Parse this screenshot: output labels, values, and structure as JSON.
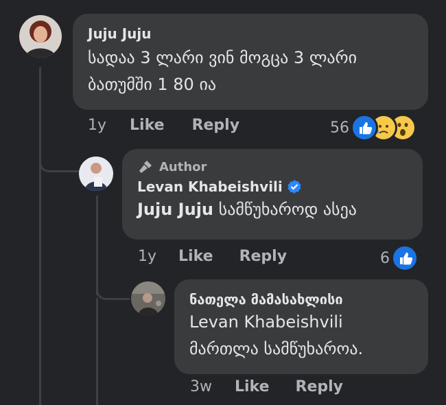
{
  "comments": [
    {
      "author": "Juju Juju",
      "text": "სადაა 3 ლარი ვინ მოგცა 3 ლარი ბათუმში 1 80 ია",
      "time": "1y",
      "like_label": "Like",
      "reply_label": "Reply",
      "reaction_count": "56",
      "reactions": [
        "like-icon",
        "sad-icon",
        "wow-icon"
      ]
    },
    {
      "badge": "Author",
      "author": "Levan Khabeishvili",
      "verified": true,
      "mention": "Juju Juju",
      "text": "სამწუხაროდ ასეა",
      "time": "1y",
      "like_label": "Like",
      "reply_label": "Reply",
      "reaction_count": "6",
      "reactions": [
        "like-icon"
      ]
    },
    {
      "author": "ნათელა მამასახლისი",
      "mention": "Levan Khabeishvili",
      "text": "მართლა სამწუხაროა.",
      "time": "3w",
      "like_label": "Like",
      "reply_label": "Reply"
    }
  ],
  "colors": {
    "background": "#232427",
    "bubble": "#3a3b3c",
    "like_blue": "#1b74e4",
    "verified_blue": "#2d88ff"
  }
}
